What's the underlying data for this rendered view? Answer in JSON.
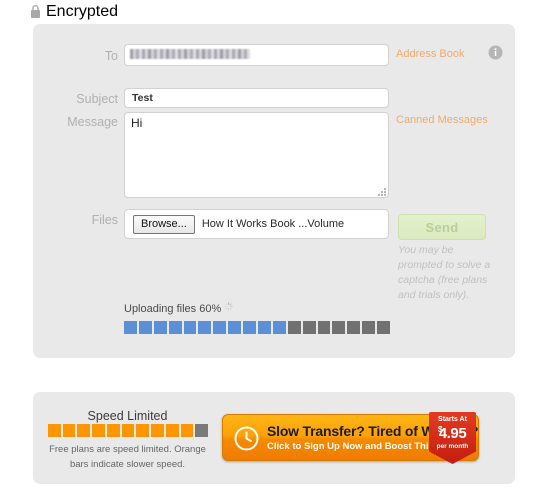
{
  "header": {
    "encrypted_label": "Encrypted",
    "lock_icon": "lock-icon"
  },
  "compose": {
    "labels": {
      "to": "To",
      "subject": "Subject",
      "message": "Message",
      "files": "Files"
    },
    "to_value": "",
    "to_placeholder": "",
    "to_redacted": true,
    "subject_value": "Test",
    "subject_placeholder": "",
    "message_value": "Hi",
    "message_placeholder": "",
    "browse_label": "Browse...",
    "file_name": "How It Works Book ...Volume",
    "address_book_link": "Address Book",
    "canned_messages_link": "Canned Messages",
    "info_icon": "info-icon",
    "send_label": "Send",
    "send_note": "You may be prompted to solve a captcha (free plans and trials only).",
    "send_enabled": false
  },
  "upload": {
    "status_text": "Uploading files 60%",
    "percent": 60,
    "spinner_icon": "spinner-icon",
    "total_segments": 18,
    "filled_segments": 11,
    "filled_color": "#5b8fd8",
    "empty_color": "#717171"
  },
  "speed": {
    "title": "Speed Limited",
    "note": "Free plans are speed limited. Orange bars indicate slower speed.",
    "total_segments": 11,
    "filled_segments": 10,
    "filled_color": "#ff9500",
    "empty_color": "#7a7a7a"
  },
  "promo": {
    "clock_icon": "clock-icon",
    "headline": "Slow Transfer? Tired of Waiting?",
    "subline": "Click to Sign Up Now and Boost This Transfer",
    "badge_top": "Starts At",
    "badge_currency": "$",
    "badge_price": "4.95",
    "badge_period": "per month",
    "accent_color": "#f58a00",
    "badge_color": "#d12a17"
  }
}
